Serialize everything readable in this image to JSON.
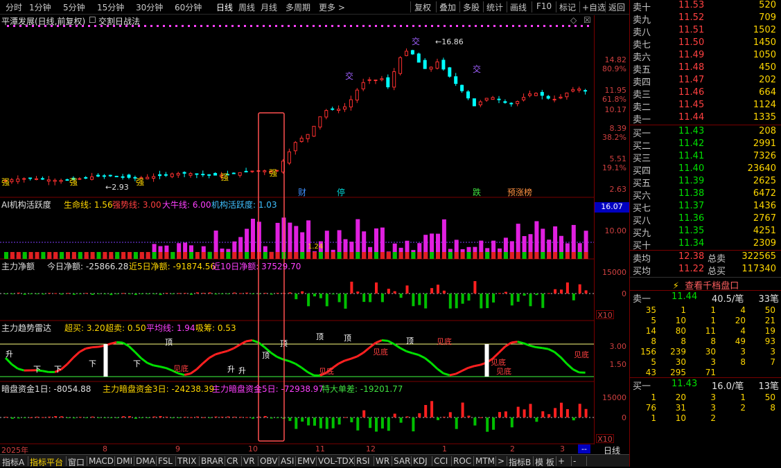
{
  "toolbar": {
    "periods": [
      "分时",
      "1分钟",
      "5分钟",
      "15分钟",
      "30分钟",
      "60分钟",
      "日线",
      "周线",
      "月线",
      "多周期",
      "更多 >"
    ],
    "active_period": "日线",
    "tools": [
      "复权",
      "叠加",
      "多股",
      "统计",
      "画线",
      "F10",
      "标记",
      "+自选",
      "返回"
    ]
  },
  "main": {
    "stock_title": "平潭发展(日线,前复权)",
    "indicator_name": "交割日战法",
    "high_label": "16.86",
    "low_label": "2.93",
    "yaxis": [
      {
        "value": "14.82",
        "pct": "80.9%"
      },
      {
        "value": "11.95",
        "pct": "61.8%"
      },
      {
        "value": "10.17",
        "pct": ""
      },
      {
        "value": "8.39",
        "pct": "38.2%"
      },
      {
        "value": "5.51",
        "pct": "19.1%"
      },
      {
        "value": "2.63",
        "pct": ""
      }
    ],
    "events": [
      "财",
      "停",
      "跌",
      "预涨榜"
    ],
    "strong_label": "强",
    "cross_label": "交"
  },
  "panel_ai": {
    "title": "AI机构活跃度",
    "lines": [
      {
        "label": "生命线: 1.56",
        "color": "#ffd700"
      },
      {
        "label": "强势线: 3.00",
        "color": "#ff4040"
      },
      {
        "label": "大牛线: 6.00",
        "color": "#ff40ff"
      },
      {
        "label": "机构活跃度: 1.03",
        "color": "#40c0ff"
      }
    ],
    "value_label": "1.24",
    "current": "16.07",
    "yaxis": [
      "10.00"
    ]
  },
  "panel_net": {
    "title": "主力净额",
    "lines": [
      {
        "label": "今日净额: -25866.28",
        "color": "#e0e0e0"
      },
      {
        "label": "近5日净额: -91874.56",
        "color": "#ffd700"
      },
      {
        "label": "近10日净额: 37529.70",
        "color": "#ff40ff"
      }
    ],
    "yaxis": [
      "15000",
      "0"
    ],
    "scale": "X10"
  },
  "panel_radar": {
    "title": "主力趋势雷达",
    "lines": [
      {
        "label": "超买: 3.20",
        "color": "#ffd700"
      },
      {
        "label": "超卖: 0.50",
        "color": "#ffd700"
      },
      {
        "label": "平均线: 1.94",
        "color": "#ff40ff"
      },
      {
        "label": "吸筹: 0.53",
        "color": "#ffd700"
      }
    ],
    "yaxis": [
      "3.00",
      "1.50"
    ],
    "marks": [
      "升",
      "下",
      "下",
      "下",
      "升",
      "下",
      "升",
      "顶",
      "顶",
      "顶",
      "顶",
      "顶",
      "顶",
      "见底",
      "见底",
      "见底",
      "见底"
    ]
  },
  "panel_dark": {
    "title": "暗盘资金1日",
    "lines": [
      {
        "label": "暗盘资金1日: -8054.88",
        "color": "#e0e0e0"
      },
      {
        "label": "主力暗盘资金3日: -24238.39",
        "color": "#ffd700"
      },
      {
        "label": "主力暗盘资金5日: -72938.97",
        "color": "#ff40ff"
      },
      {
        "label": "特大单差: -19201.77",
        "color": "#40e040"
      }
    ],
    "yaxis": [
      "15000",
      "0"
    ],
    "scale": "X10"
  },
  "dates": [
    "2025年",
    "8",
    "9",
    "10",
    "11",
    "12",
    "1",
    "2",
    "3"
  ],
  "orderbook": {
    "sells": [
      {
        "label": "卖十",
        "price": "11.53",
        "vol": "520"
      },
      {
        "label": "卖九",
        "price": "11.52",
        "vol": "709"
      },
      {
        "label": "卖八",
        "price": "11.51",
        "vol": "1502"
      },
      {
        "label": "卖七",
        "price": "11.50",
        "vol": "1450"
      },
      {
        "label": "卖六",
        "price": "11.49",
        "vol": "1050"
      },
      {
        "label": "卖五",
        "price": "11.48",
        "vol": "450"
      },
      {
        "label": "卖四",
        "price": "11.47",
        "vol": "202"
      },
      {
        "label": "卖三",
        "price": "11.46",
        "vol": "664"
      },
      {
        "label": "卖二",
        "price": "11.45",
        "vol": "1124"
      },
      {
        "label": "卖一",
        "price": "11.44",
        "vol": "1335"
      }
    ],
    "buys": [
      {
        "label": "买一",
        "price": "11.43",
        "vol": "208"
      },
      {
        "label": "买二",
        "price": "11.42",
        "vol": "2991"
      },
      {
        "label": "买三",
        "price": "11.41",
        "vol": "7326"
      },
      {
        "label": "买四",
        "price": "11.40",
        "vol": "23640"
      },
      {
        "label": "买五",
        "price": "11.39",
        "vol": "2625"
      },
      {
        "label": "买六",
        "price": "11.38",
        "vol": "6472"
      },
      {
        "label": "买七",
        "price": "11.37",
        "vol": "1436"
      },
      {
        "label": "买八",
        "price": "11.36",
        "vol": "2767"
      },
      {
        "label": "买九",
        "price": "11.35",
        "vol": "4251"
      },
      {
        "label": "买十",
        "price": "11.34",
        "vol": "2309"
      }
    ],
    "avg_sell_label": "卖均",
    "avg_sell": "12.38",
    "total_sell_label": "总卖",
    "total_sell": "322565",
    "avg_buy_label": "买均",
    "avg_buy": "11.22",
    "total_buy_label": "总买",
    "total_buy": "117340",
    "depth_button": "查看千档盘口",
    "sell1": {
      "label": "卖一",
      "price": "11.44",
      "avg": "40.5/笔",
      "count": "33笔",
      "queue": [
        [
          "35",
          "1",
          "1",
          "4",
          "50"
        ],
        [
          "5",
          "10",
          "1",
          "20",
          "21"
        ],
        [
          "14",
          "80",
          "11",
          "4",
          "19"
        ],
        [
          "8",
          "8",
          "8",
          "49",
          "93"
        ],
        [
          "156",
          "239",
          "30",
          "3",
          "3"
        ],
        [
          "5",
          "30",
          "3",
          "8",
          "7"
        ],
        [
          "43",
          "295",
          "71",
          "",
          ""
        ]
      ]
    },
    "buy1": {
      "label": "买一",
      "price": "11.43",
      "avg": "16.0/笔",
      "count": "13笔",
      "queue": [
        [
          "1",
          "20",
          "3",
          "1",
          "50"
        ],
        [
          "76",
          "31",
          "3",
          "2",
          "8"
        ],
        [
          "1",
          "10",
          "2",
          "",
          ""
        ]
      ]
    }
  },
  "bottom_tabs": [
    "指标A",
    "指标平台",
    "窗口",
    "MACD",
    "DMI",
    "DMA",
    "FSL",
    "TRIX",
    "BRAR",
    "CR",
    "VR",
    "OBV",
    "ASI",
    "EMV",
    "VOL-TDX",
    "RSI",
    "WR",
    "SAR",
    "KDJ",
    "CCI",
    "ROC",
    "MTM",
    ">",
    "指标B",
    "模 板",
    "+",
    "-"
  ],
  "bottom_active": "指标平台",
  "period_label": "日线"
}
